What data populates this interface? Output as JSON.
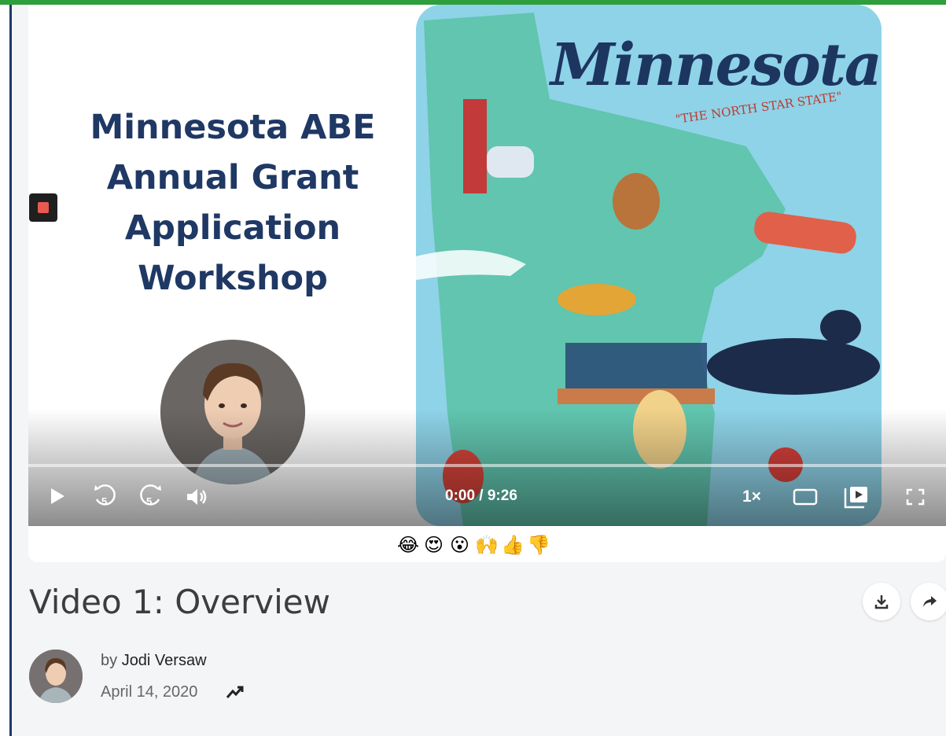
{
  "slide": {
    "title_lines": [
      "Minnesota ABE",
      "Annual Grant",
      "Application",
      "Workshop"
    ]
  },
  "map": {
    "title": "Minnesota",
    "subtitle": "\"THE NORTH STAR STATE\""
  },
  "player": {
    "time_display": "0:00 / 9:26",
    "speed_label": "1×",
    "rewind_label": "5",
    "forward_label": "5",
    "progress_fraction": 0.0
  },
  "reactions": [
    "😂",
    "😍",
    "😮",
    "🙌",
    "👍",
    "👎"
  ],
  "video": {
    "title": "Video 1: Overview"
  },
  "author": {
    "by_prefix": "by",
    "name": "Jodi Versaw",
    "date": "April 14, 2020"
  },
  "colors": {
    "accent_green": "#2f9e3c",
    "border_navy": "#1b3a6b",
    "slide_title": "#1f3864",
    "stop_red": "#e85a4f"
  },
  "icons": [
    "stop-icon",
    "play-icon",
    "rewind-5-icon",
    "forward-5-icon",
    "volume-icon",
    "theater-mode-icon",
    "picture-in-picture-icon",
    "fullscreen-icon",
    "download-icon",
    "share-icon",
    "trending-icon"
  ]
}
